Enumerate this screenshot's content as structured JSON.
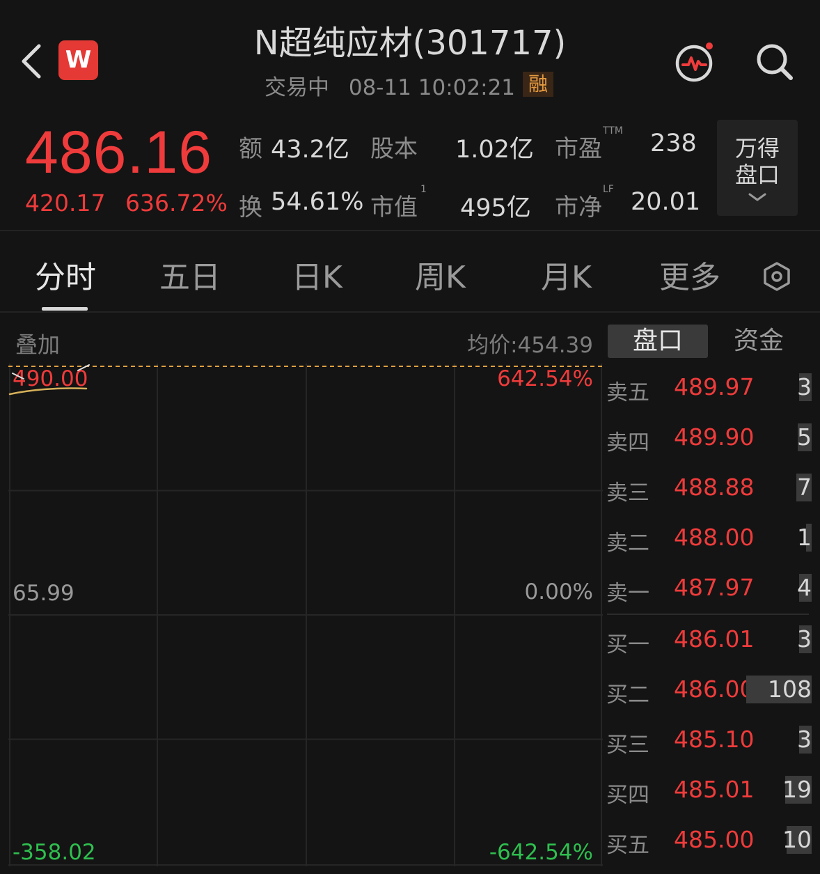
{
  "header": {
    "title": "N超纯应材(301717)",
    "status": "交易中",
    "datetime": "08-11 10:02:21",
    "margin_badge": "融",
    "logo_letter": "W"
  },
  "quote": {
    "price": "486.16",
    "change": "420.17",
    "change_pct": "636.72%",
    "stats": {
      "amount_label": "额",
      "amount": "43.2亿",
      "share_cap_label": "股本",
      "share_cap": "1.02亿",
      "pe_label": "市盈",
      "pe_sup": "TTM",
      "pe": "238",
      "turnover_label": "换",
      "turnover": "54.61%",
      "mkt_cap_label": "市值",
      "mkt_cap_sup": "1",
      "mkt_cap": "495亿",
      "pb_label": "市净",
      "pb_sup": "LF",
      "pb": "20.01"
    },
    "wind_panel": {
      "line1": "万得",
      "line2": "盘口"
    }
  },
  "tabs": [
    "分时",
    "五日",
    "日K",
    "周K",
    "月K",
    "更多"
  ],
  "chart": {
    "overlay_label": "叠加",
    "avg_price": "均价:454.39",
    "top_price": "490.00",
    "top_pct": "642.54%",
    "mid_price": "65.99",
    "mid_pct": "0.00%",
    "bottom_price": "-358.02",
    "bottom_pct": "-642.54%"
  },
  "chart_data": {
    "type": "line",
    "ylim": [
      -358.02,
      490.0
    ],
    "y_ticks": [
      490.0,
      65.99,
      -358.02
    ],
    "pct_ticks": [
      "642.54%",
      "0.00%",
      "-642.54%"
    ],
    "reference_price": 65.99,
    "reference_line": 490.0,
    "series": []
  },
  "orderbook": {
    "tabs": [
      "盘口",
      "资金"
    ],
    "asks": [
      {
        "label": "卖五",
        "price": "489.97",
        "vol": "3"
      },
      {
        "label": "卖四",
        "price": "489.90",
        "vol": "5"
      },
      {
        "label": "卖三",
        "price": "488.88",
        "vol": "7"
      },
      {
        "label": "卖二",
        "price": "488.00",
        "vol": "1"
      },
      {
        "label": "卖一",
        "price": "487.97",
        "vol": "4"
      }
    ],
    "bids": [
      {
        "label": "买一",
        "price": "486.01",
        "vol": "3"
      },
      {
        "label": "买二",
        "price": "486.00",
        "vol": "108"
      },
      {
        "label": "买三",
        "price": "485.10",
        "vol": "3"
      },
      {
        "label": "买四",
        "price": "485.01",
        "vol": "19"
      },
      {
        "label": "买五",
        "price": "485.00",
        "vol": "10"
      }
    ]
  },
  "colors": {
    "up": "#ef3b3b",
    "down": "#2fbf4f",
    "background": "#141414",
    "ref_line": "#e0a040"
  }
}
